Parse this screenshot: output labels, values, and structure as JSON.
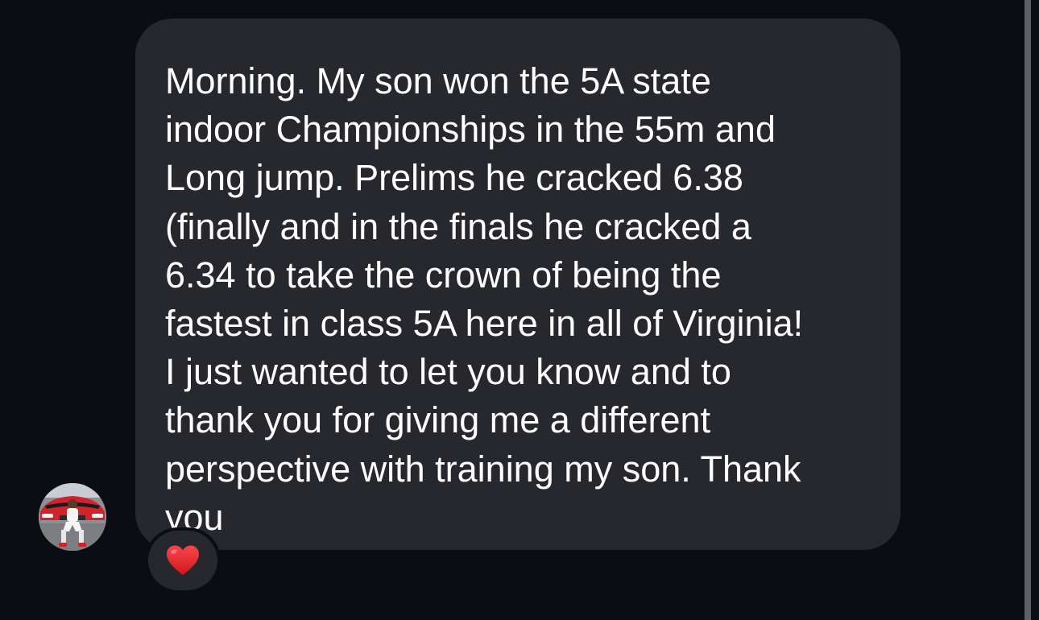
{
  "conversation": {
    "message": {
      "text": "Morning. My son won the 5A state\nindoor Championships in the 55m and\nLong jump. Prelims he cracked 6.38\n(finally and in the finals he cracked a\n6.34 to take the crown of being the\nfastest in class 5A here in all of Virginia!\nI just wanted to let you know and to\nthank you for giving me a different\nperspective with training my son. Thank\nyou",
      "reaction": {
        "icon": "red-heart-icon",
        "color": "#e0242b"
      }
    },
    "sender": {
      "avatar_icon": "profile-photo"
    }
  },
  "colors": {
    "background": "#0b0d12",
    "bubble": "#26282d",
    "text": "#ffffff",
    "scrollbar": "#5c5f66"
  }
}
